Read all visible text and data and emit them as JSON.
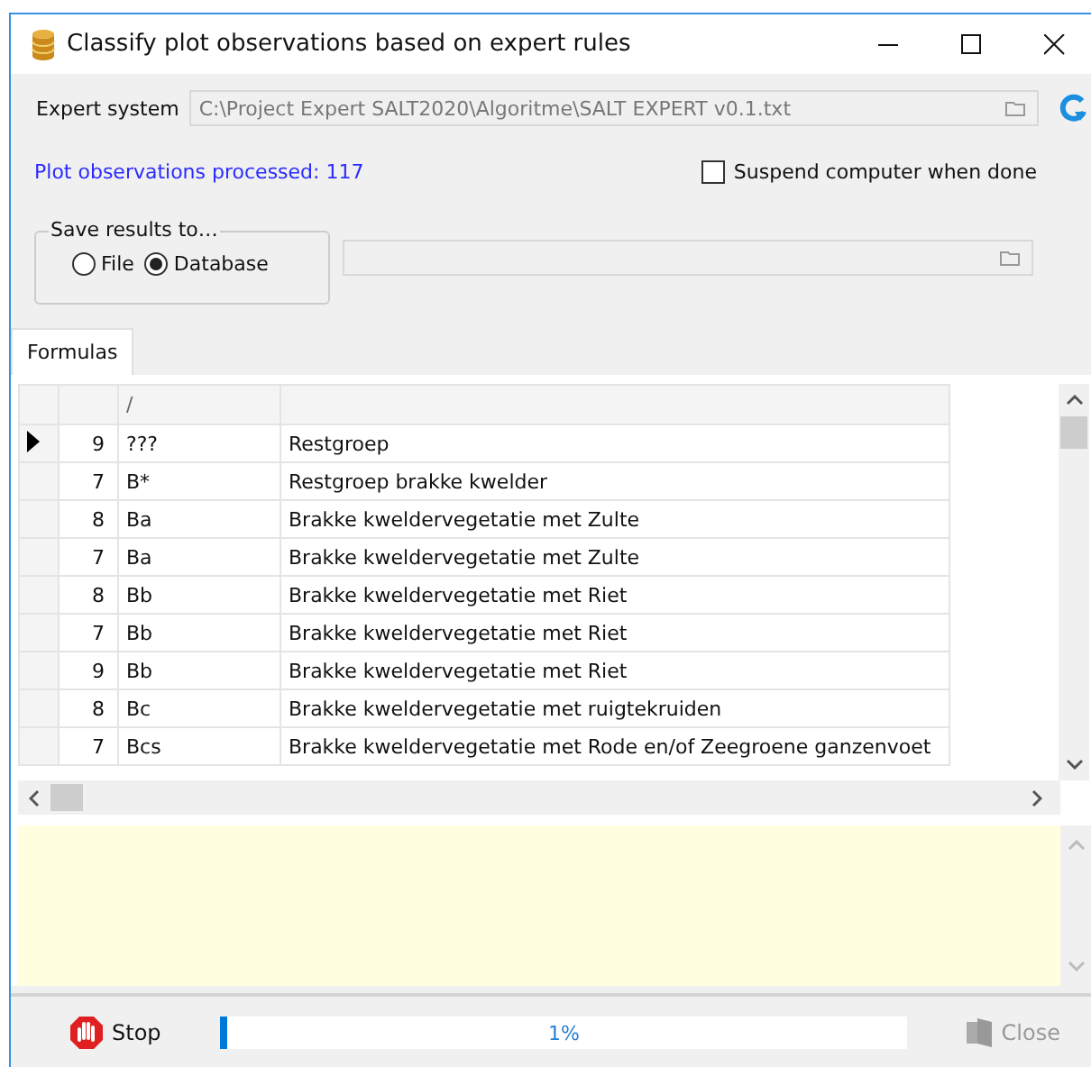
{
  "window": {
    "title": "Classify plot observations based on expert rules"
  },
  "expert_system": {
    "label": "Expert system",
    "value": "C:\\Project Expert SALT2020\\Algoritme\\SALT EXPERT v0.1.txt",
    "disabled": true
  },
  "processed": "Plot observations processed: 117",
  "suspend": {
    "label": "Suspend computer when done",
    "checked": false
  },
  "save_results": {
    "title": "Save results to…",
    "options": [
      {
        "label": "File",
        "selected": false
      },
      {
        "label": "Database",
        "selected": true
      }
    ]
  },
  "tabs": [
    {
      "label": "Formulas",
      "selected": true
    }
  ],
  "table": {
    "columns": [
      "",
      "/",
      ""
    ],
    "rows": [
      {
        "selected": true,
        "cells": [
          "9",
          "???",
          "Restgroep"
        ]
      },
      {
        "selected": false,
        "cells": [
          "7",
          "B*",
          "Restgroep brakke kwelder"
        ]
      },
      {
        "selected": false,
        "cells": [
          "8",
          "Ba",
          "Brakke kweldervegetatie met Zulte"
        ]
      },
      {
        "selected": false,
        "cells": [
          "7",
          "Ba",
          "Brakke kweldervegetatie met Zulte"
        ]
      },
      {
        "selected": false,
        "cells": [
          "8",
          "Bb",
          "Brakke kweldervegetatie met Riet"
        ]
      },
      {
        "selected": false,
        "cells": [
          "7",
          "Bb",
          "Brakke kweldervegetatie met Riet"
        ]
      },
      {
        "selected": false,
        "cells": [
          "9",
          "Bb",
          "Brakke kweldervegetatie met Riet"
        ]
      },
      {
        "selected": false,
        "cells": [
          "8",
          "Bc",
          "Brakke kweldervegetatie met ruigtekruiden"
        ]
      },
      {
        "selected": false,
        "cells": [
          "7",
          "Bcs",
          "Brakke kweldervegetatie met Rode en/of Zeegroene ganzenvoet"
        ]
      }
    ]
  },
  "bottom": {
    "stop": "Stop",
    "progress": {
      "level": 0.01,
      "reading": "1%"
    },
    "close": {
      "label": "Close",
      "disabled": true
    }
  }
}
